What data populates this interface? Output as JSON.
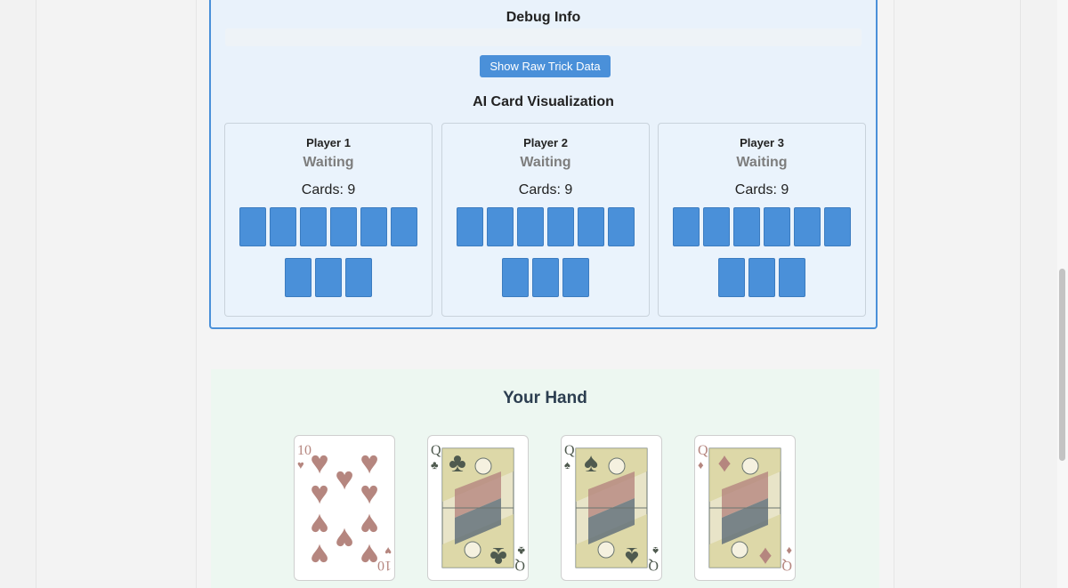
{
  "debug": {
    "title": "Debug Info",
    "raw_button_label": "Show Raw Trick Data",
    "ai_title": "AI Card Visualization"
  },
  "players": [
    {
      "name": "Player 1",
      "status": "Waiting",
      "cards_label": "Cards: 9",
      "card_count": 9
    },
    {
      "name": "Player 2",
      "status": "Waiting",
      "cards_label": "Cards: 9",
      "card_count": 9
    },
    {
      "name": "Player 3",
      "status": "Waiting",
      "cards_label": "Cards: 9",
      "card_count": 9
    }
  ],
  "hand": {
    "title": "Your Hand",
    "cards": [
      {
        "rank": "10",
        "suit": "hearts",
        "suit_symbol": "♥",
        "color": "#b5867f"
      },
      {
        "rank": "Q",
        "suit": "clubs",
        "suit_symbol": "♣",
        "color": "#4f5a4f"
      },
      {
        "rank": "Q",
        "suit": "spades",
        "suit_symbol": "♠",
        "color": "#4f5a4f"
      },
      {
        "rank": "Q",
        "suit": "diamonds",
        "suit_symbol": "♦",
        "color": "#b5867f"
      }
    ]
  },
  "colors": {
    "accent": "#4a90d9",
    "debug_bg": "#e9f2fb",
    "hand_bg": "#edf7f1"
  }
}
